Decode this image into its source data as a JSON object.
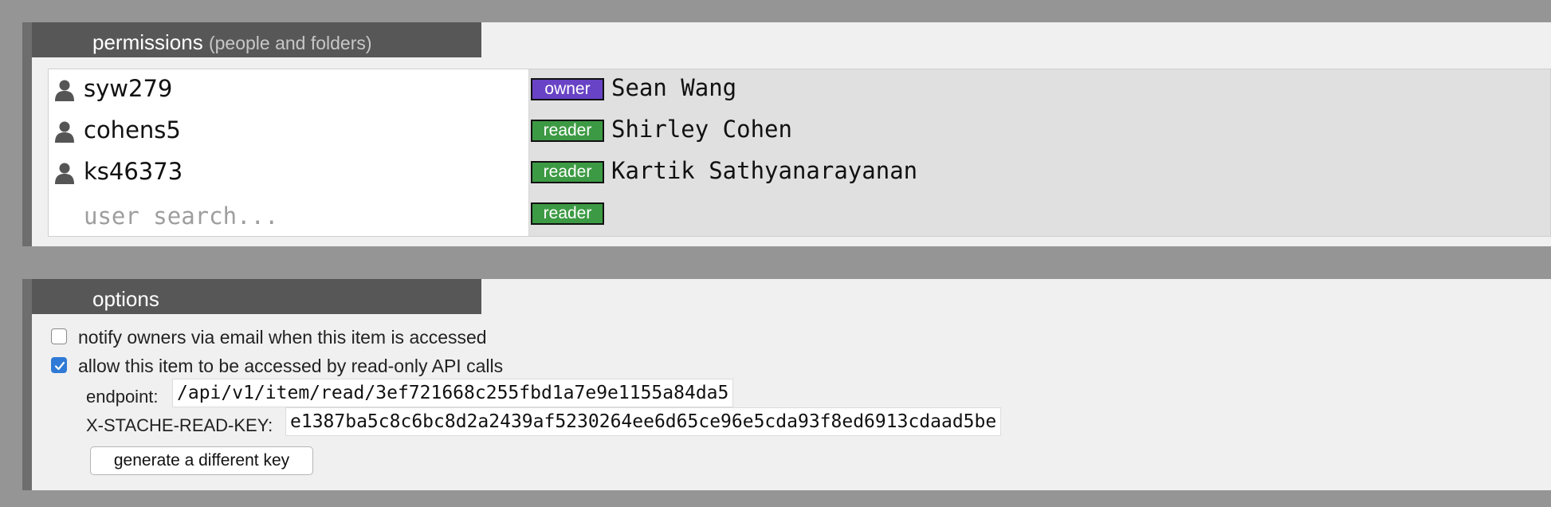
{
  "permissions": {
    "title": "permissions",
    "subtitle": "(people and folders)",
    "users": [
      {
        "username": "syw279",
        "role": "owner",
        "name": "Sean Wang"
      },
      {
        "username": "cohens5",
        "role": "reader",
        "name": "Shirley Cohen"
      },
      {
        "username": "ks46373",
        "role": "reader",
        "name": "Kartik Sathyanarayanan"
      }
    ],
    "search_placeholder": "user search...",
    "new_role": "reader",
    "icon": "person-icon"
  },
  "options": {
    "title": "options",
    "notify_label": "notify owners via email when this item is accessed",
    "notify_checked": false,
    "api_label": "allow this item to be accessed by read-only API calls",
    "api_checked": true,
    "endpoint_label": "endpoint:",
    "endpoint_value": "/api/v1/item/read/3ef721668c255fbd1a7e9e1155a84da5",
    "key_label": "X-STACHE-READ-KEY:",
    "key_value": "e1387ba5c8c6bc8d2a2439af5230264ee6d65ce96e5cda93f8ed6913cdaad5be",
    "generate_button": "generate a different key"
  },
  "colors": {
    "owner": "#6843c5",
    "reader": "#3d9a44",
    "header": "#575757",
    "checkbox": "#2f7ad6"
  }
}
